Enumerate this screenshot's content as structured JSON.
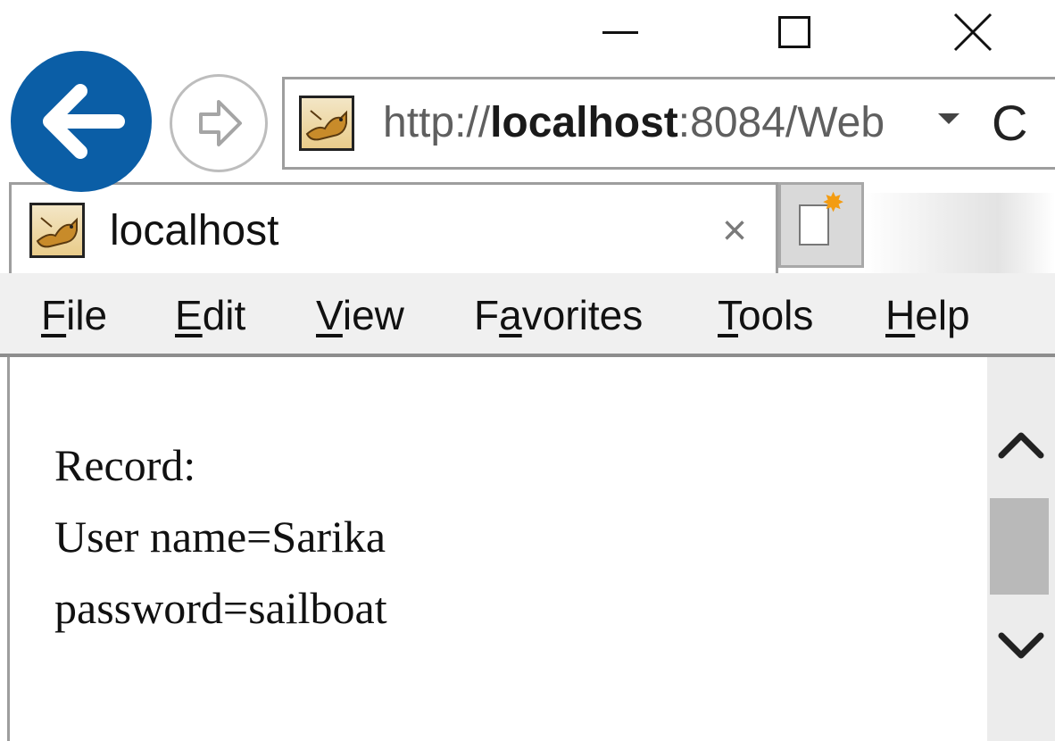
{
  "window": {
    "controls": {
      "minimize_icon": "minimize-icon",
      "maximize_icon": "maximize-icon",
      "close_icon": "close-icon"
    }
  },
  "navigation": {
    "back_icon": "arrow-left-icon",
    "forward_icon": "arrow-right-icon",
    "back_color": "#0b5ea6"
  },
  "address_bar": {
    "url_prefix": "http://",
    "url_host": "localhost",
    "url_suffix": ":8084/Web",
    "dropdown_icon": "chevron-down-icon",
    "refresh_icon": "refresh-icon",
    "refresh_glyph": "C"
  },
  "tab": {
    "title": "localhost",
    "close_glyph": "×",
    "favicon_icon": "tomcat-icon",
    "new_tab_icon": "new-tab-icon"
  },
  "menu": {
    "items": [
      {
        "accel": "F",
        "rest": "ile"
      },
      {
        "accel": "E",
        "rest": "dit"
      },
      {
        "accel": "V",
        "rest": "iew"
      },
      {
        "pre": "F",
        "accel": "a",
        "rest": "vorites"
      },
      {
        "accel": "T",
        "rest": "ools"
      },
      {
        "accel": "H",
        "rest": "elp"
      }
    ]
  },
  "page": {
    "lines": [
      "Record:",
      "User name=Sarika",
      "password=sailboat"
    ]
  },
  "scrollbar": {
    "up_icon": "chevron-up-icon",
    "down_icon": "chevron-down-icon"
  }
}
